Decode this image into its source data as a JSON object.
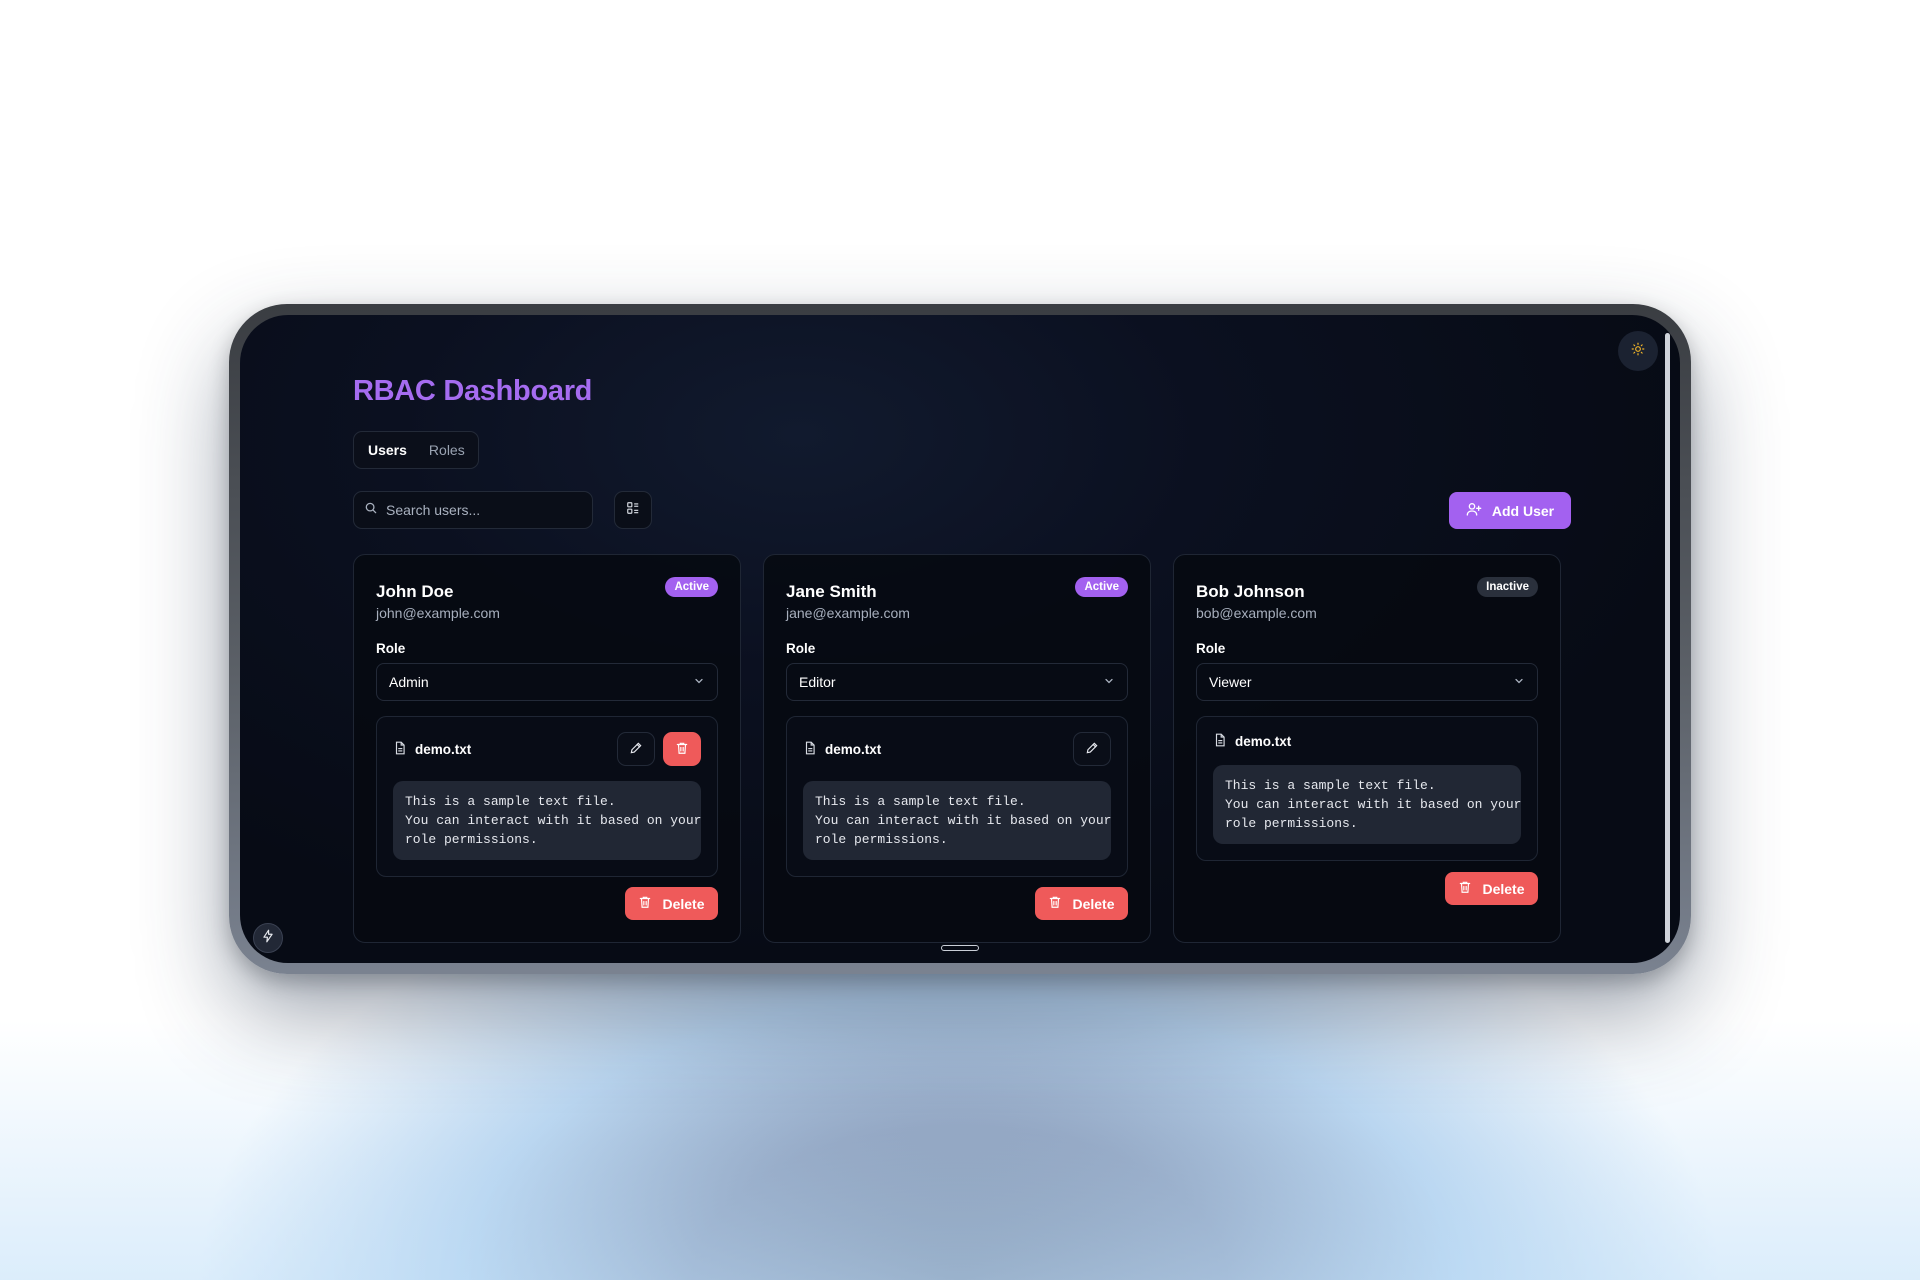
{
  "app": {
    "title": "RBAC Dashboard"
  },
  "tabs": [
    {
      "label": "Users",
      "active": true
    },
    {
      "label": "Roles",
      "active": false
    }
  ],
  "search": {
    "placeholder": "Search users...",
    "value": ""
  },
  "toolbar": {
    "add_user_label": "Add User"
  },
  "icons": {
    "theme_toggle": "sun-icon",
    "view_toggle": "list-view-icon",
    "add_user": "user-plus-icon",
    "file": "file-icon",
    "edit": "pencil-icon",
    "delete": "trash-icon",
    "chevron": "chevron-down-icon",
    "bolt": "bolt-icon"
  },
  "colors": {
    "accent": "#a361f0",
    "title": "#a56cf0",
    "danger": "#ef5a5a",
    "active_badge": "#a361f0",
    "inactive_badge": "#2a303c"
  },
  "role_label": "Role",
  "delete_label": "Delete",
  "users": [
    {
      "name": "John Doe",
      "email": "john@example.com",
      "status": "Active",
      "role": "Admin",
      "file": {
        "name": "demo.txt",
        "content": "This is a sample text file.\nYou can interact with it based on your\nrole permissions.",
        "can_edit": true,
        "can_delete": true
      }
    },
    {
      "name": "Jane Smith",
      "email": "jane@example.com",
      "status": "Active",
      "role": "Editor",
      "file": {
        "name": "demo.txt",
        "content": "This is a sample text file.\nYou can interact with it based on your\nrole permissions.",
        "can_edit": true,
        "can_delete": false
      }
    },
    {
      "name": "Bob Johnson",
      "email": "bob@example.com",
      "status": "Inactive",
      "role": "Viewer",
      "file": {
        "name": "demo.txt",
        "content": "This is a sample text file.\nYou can interact with it based on your\nrole permissions.",
        "can_edit": false,
        "can_delete": false
      }
    }
  ]
}
